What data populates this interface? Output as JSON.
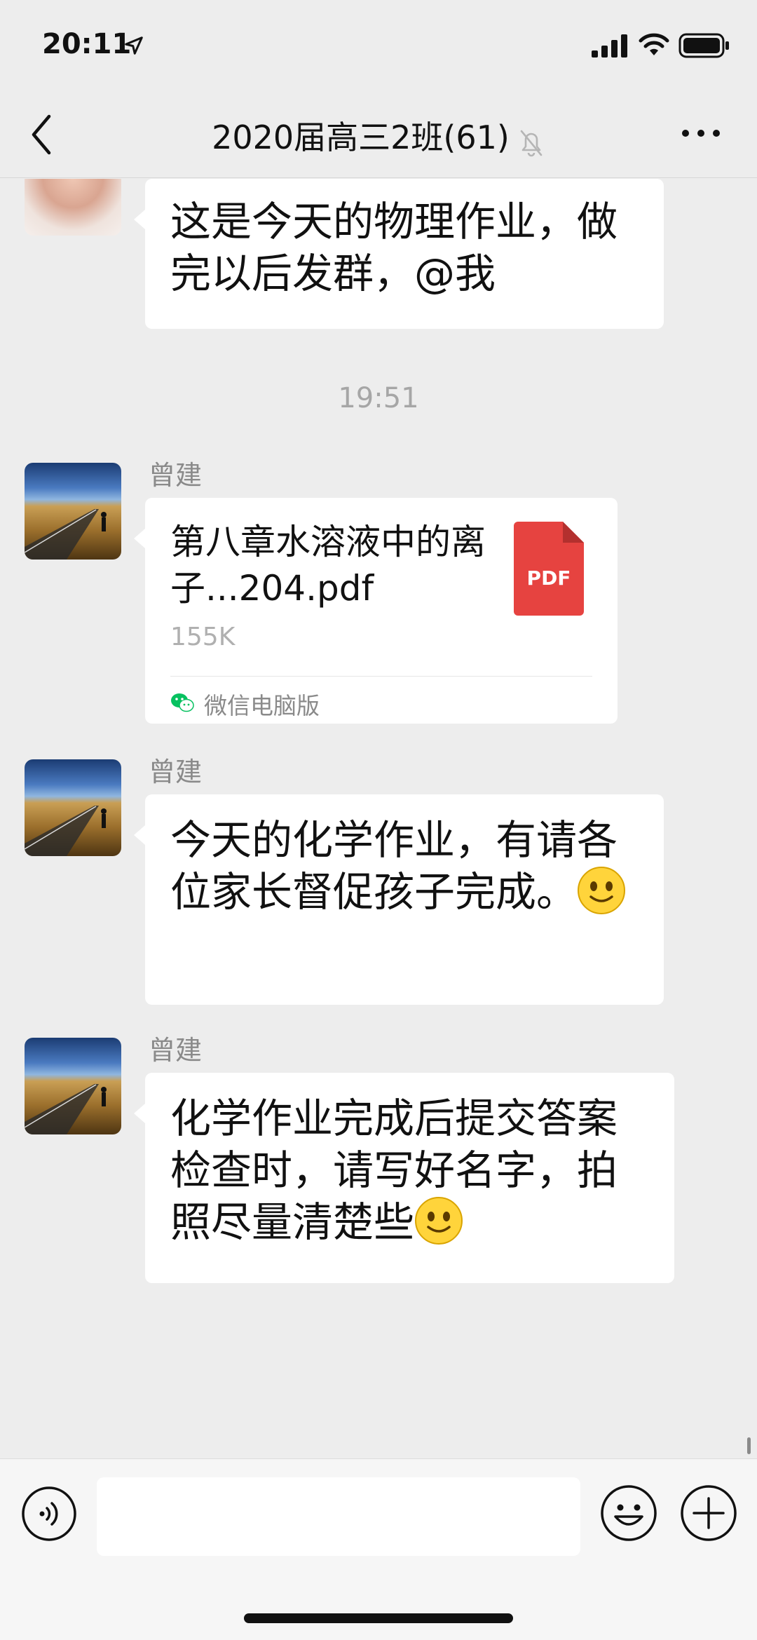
{
  "status_bar": {
    "time": "20:11"
  },
  "nav": {
    "title": "2020届高三2班(61)"
  },
  "messages": {
    "m1": {
      "text": "这是今天的物理作业，做完以后发群，@我"
    },
    "timestamp": "19:51",
    "m2": {
      "sender": "曾建",
      "file_name": "第八章水溶液中的离子...204.pdf",
      "file_type": "PDF",
      "file_size": "155K",
      "source": "微信电脑版"
    },
    "m3": {
      "sender": "曾建",
      "text": "今天的化学作业，有请各位家长督促孩子完成。"
    },
    "m4": {
      "sender": "曾建",
      "text": "化学作业完成后提交答案检查时，请写好名字，拍照尽量清楚些"
    }
  },
  "icons": {
    "back": "chevron-left-icon",
    "mute": "bell-slash-icon",
    "more": "more-dots-icon",
    "voice": "voice-icon",
    "emoji": "emoji-icon",
    "plus": "plus-icon"
  },
  "colors": {
    "background": "#ededed",
    "bubble": "#ffffff",
    "pdf": "#e64340",
    "wechat_green": "#07c160"
  },
  "input": {
    "value": ""
  }
}
